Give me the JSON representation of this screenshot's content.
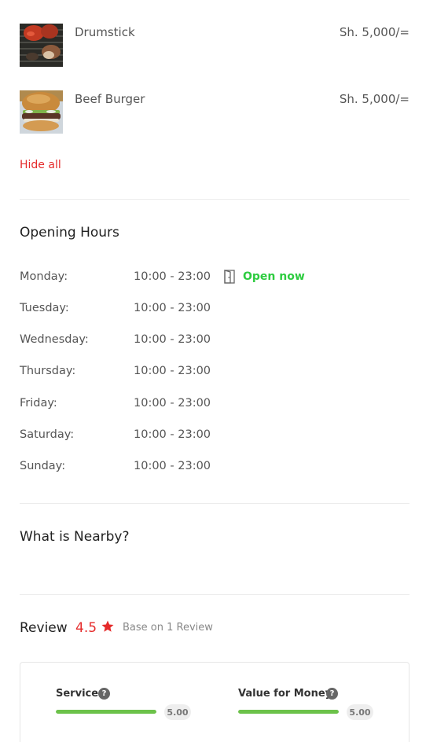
{
  "menu": {
    "items": [
      {
        "name": "Drumstick",
        "price": "Sh. 5,000/="
      },
      {
        "name": "Beef Burger",
        "price": "Sh. 5,000/="
      }
    ],
    "hide_all_label": "Hide all"
  },
  "opening_hours": {
    "title": "Opening Hours",
    "status": "Open now",
    "rows": [
      {
        "day": "Monday:",
        "time": "10:00 - 23:00"
      },
      {
        "day": "Tuesday:",
        "time": "10:00 - 23:00"
      },
      {
        "day": "Wednesday:",
        "time": "10:00 - 23:00"
      },
      {
        "day": "Thursday:",
        "time": "10:00 - 23:00"
      },
      {
        "day": "Friday:",
        "time": "10:00 - 23:00"
      },
      {
        "day": "Saturday:",
        "time": "10:00 - 23:00"
      },
      {
        "day": "Sunday:",
        "time": "10:00 - 23:00"
      }
    ]
  },
  "nearby": {
    "title": "What is Nearby?"
  },
  "review": {
    "label": "Review",
    "score": "4.5",
    "base_text": "Base on 1 Review",
    "criteria": [
      {
        "label": "Service",
        "value": "5.00",
        "fraction": 1.0
      },
      {
        "label": "Value for Money",
        "value": "5.00",
        "fraction": 1.0
      }
    ]
  },
  "colors": {
    "accent_red": "#e52b2b",
    "open_green": "#2ecc40",
    "bar_green": "#6cc24a"
  }
}
